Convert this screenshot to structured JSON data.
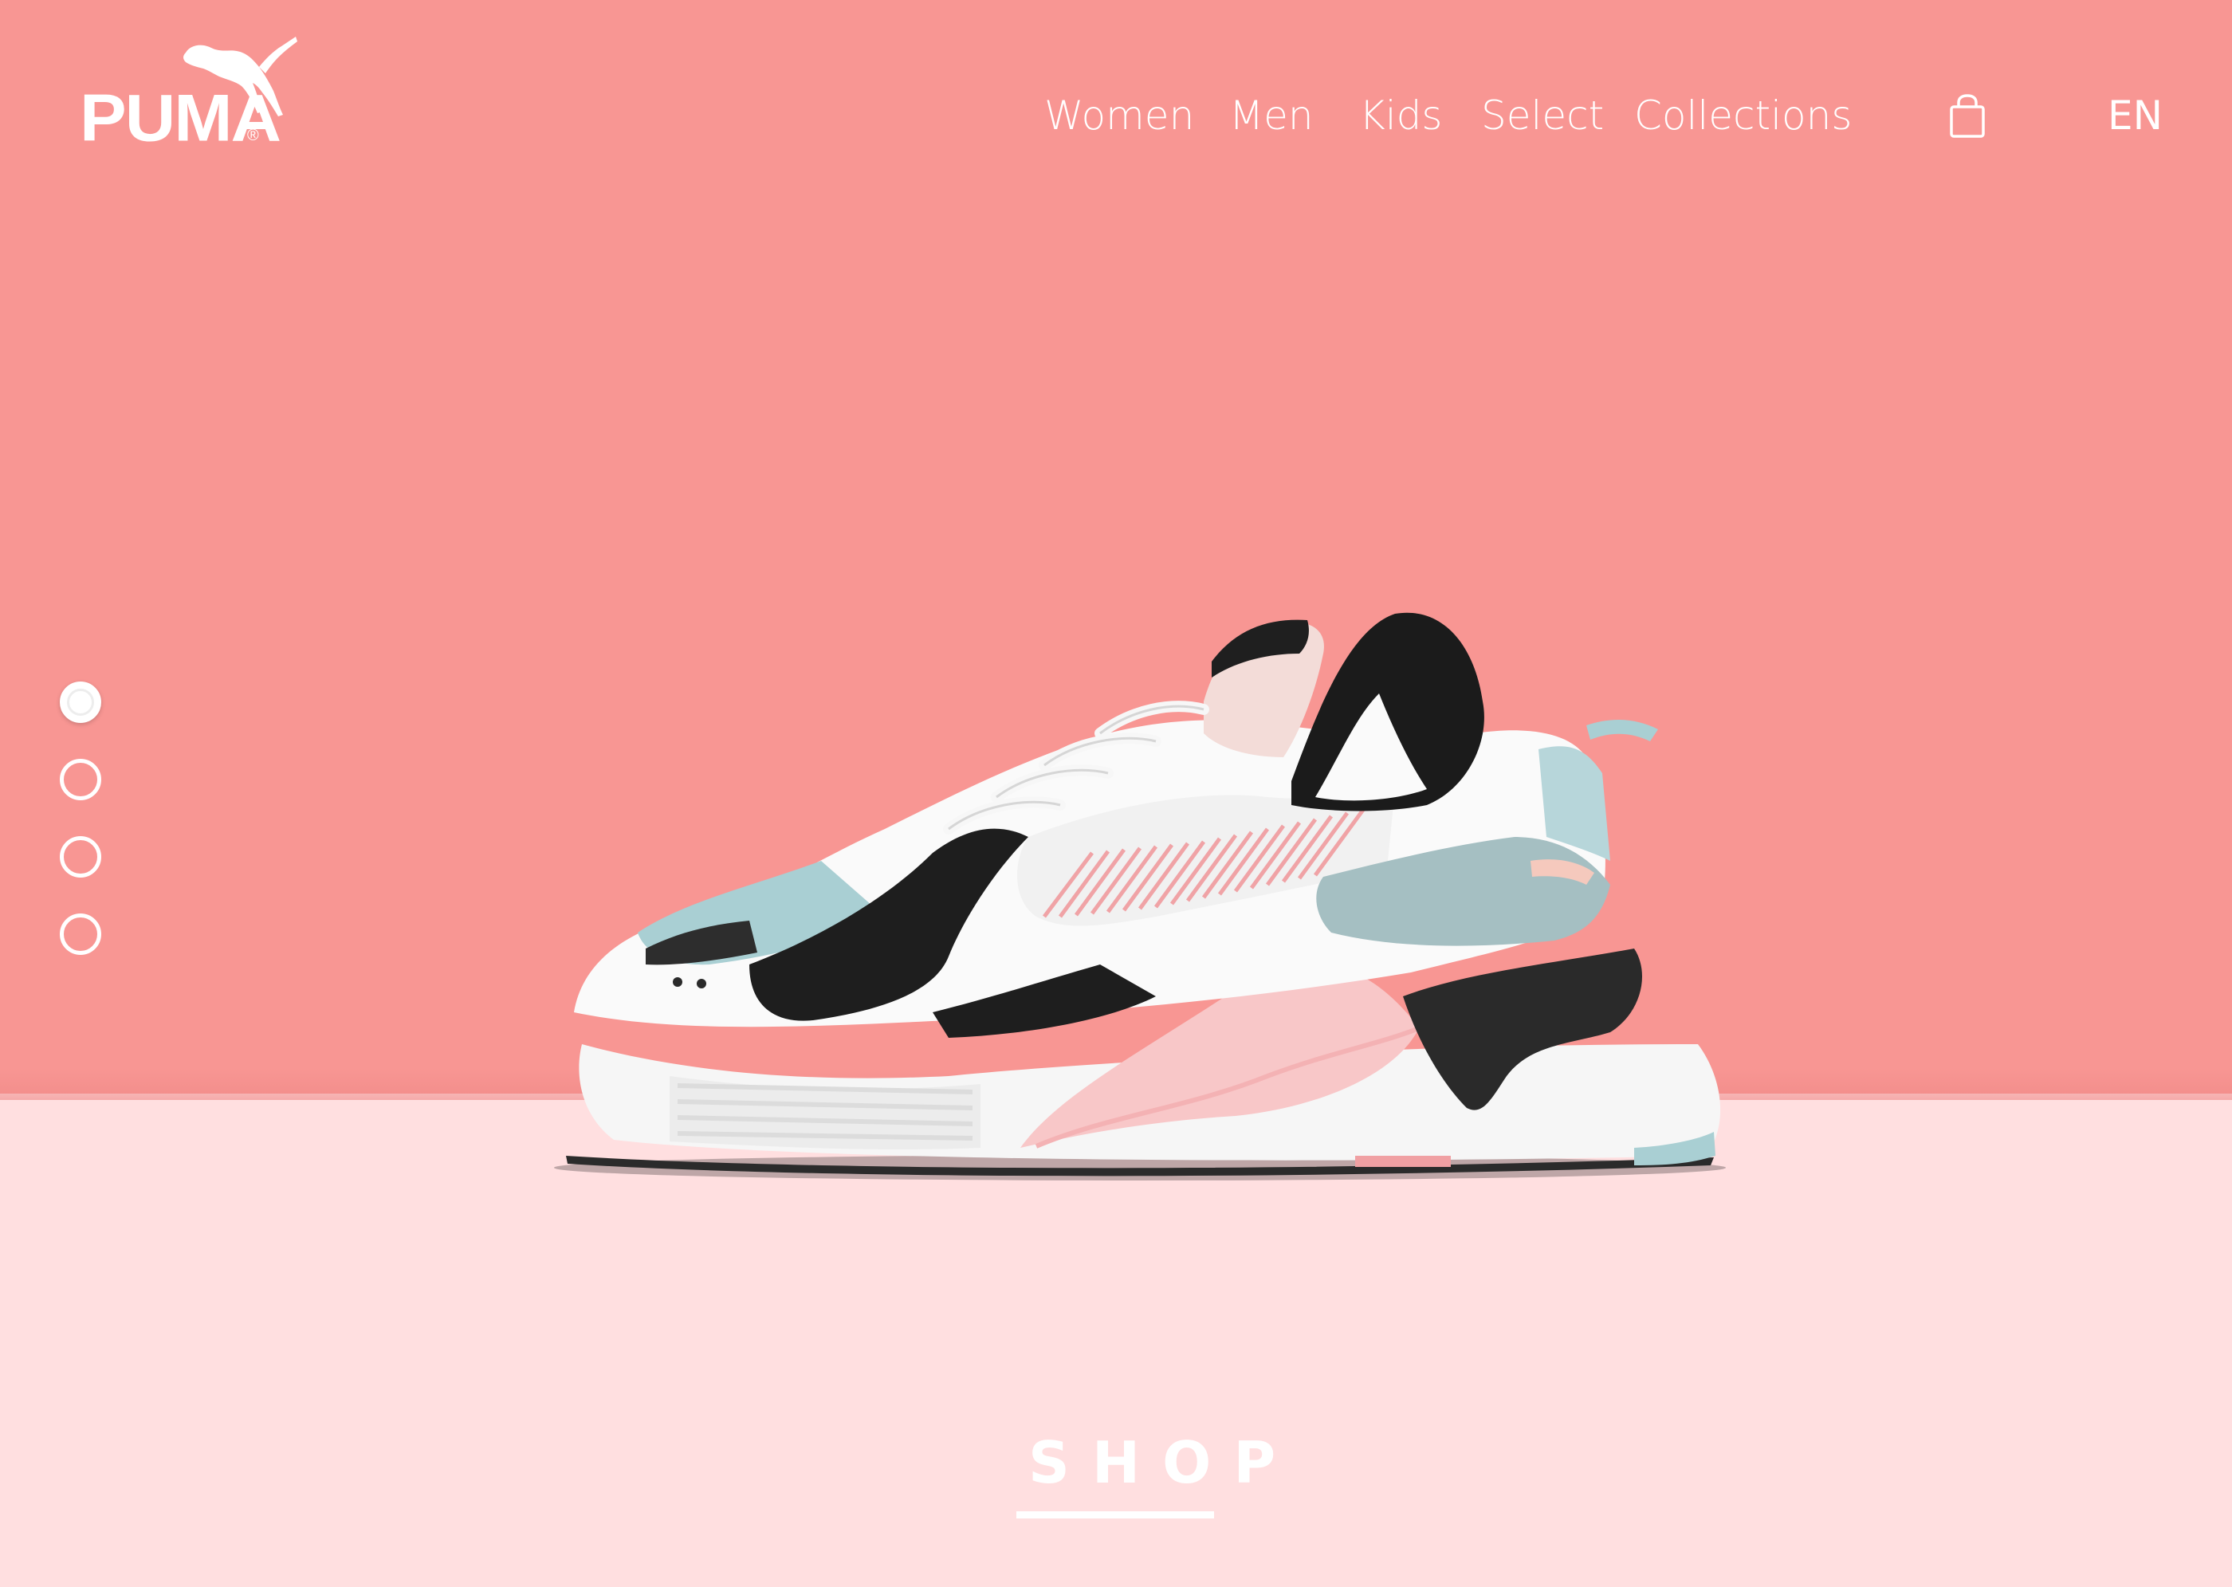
{
  "brand": {
    "name": "PUMA",
    "registered": "®"
  },
  "nav": {
    "items": [
      {
        "label": "Women"
      },
      {
        "label": "Men"
      },
      {
        "label": "Kids"
      },
      {
        "label": "Select"
      },
      {
        "label": "Collections"
      }
    ],
    "cart_icon": "shopping-bag-icon",
    "language": "EN"
  },
  "slider": {
    "count": 4,
    "active_index": 0
  },
  "hero": {
    "product_image": "sneaker-white-pink-black-mint",
    "cta_label": "SHOP"
  },
  "colors": {
    "background_top": "#f89693",
    "background_floor": "#ffdfe0",
    "text": "#ffffff"
  }
}
